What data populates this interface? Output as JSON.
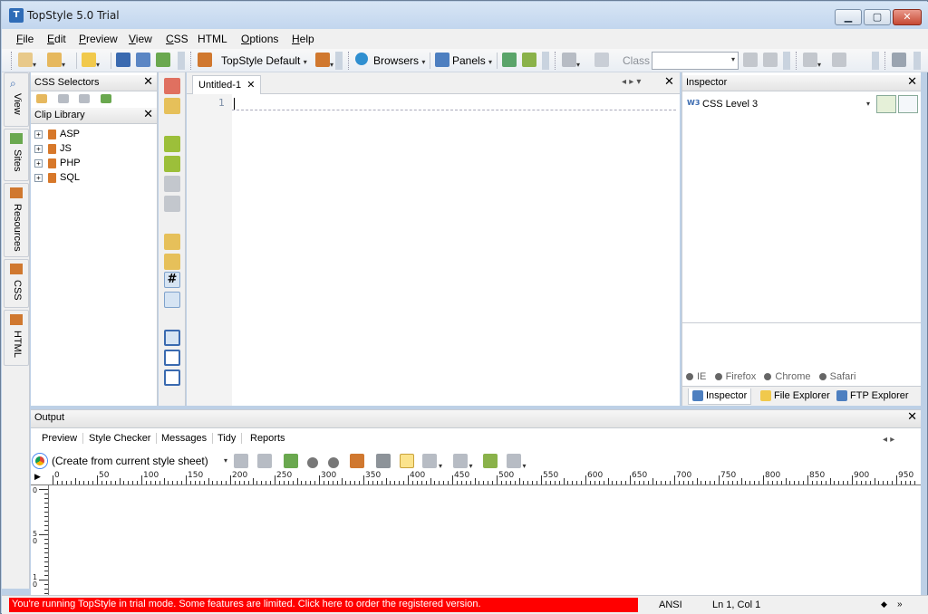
{
  "window": {
    "title": "TopStyle 5.0 Trial",
    "min": "▁",
    "max": "▢",
    "close": "✕"
  },
  "menu": [
    {
      "label": "File",
      "u": "F",
      "rest": "ile"
    },
    {
      "label": "Edit",
      "u": "E",
      "rest": "dit"
    },
    {
      "label": "Preview",
      "u": "P",
      "rest": "review"
    },
    {
      "label": "View",
      "u": "V",
      "rest": "iew"
    },
    {
      "label": "CSS",
      "u": "C",
      "rest": "SS"
    },
    {
      "label": "HTML",
      "u": "",
      "rest": "HTML"
    },
    {
      "label": "Options",
      "u": "O",
      "rest": "ptions"
    },
    {
      "label": "Help",
      "u": "H",
      "rest": "elp"
    }
  ],
  "toolbar": {
    "style_label": "TopStyle Default",
    "browsers_label": "Browsers",
    "panels_label": "Panels",
    "class_label": "Class",
    "class_value": ""
  },
  "sidetabs": [
    "View",
    "Sites",
    "Resources",
    "CSS",
    "HTML"
  ],
  "left": {
    "css_selectors": "CSS Selectors",
    "clip_library": "Clip Library",
    "items": [
      "ASP",
      "JS",
      "PHP",
      "SQL"
    ],
    "close": "✕"
  },
  "editor": {
    "tab": "Untitled-1",
    "tab_close": "✕",
    "line_no": "1",
    "nav": "◂ ▸ ▾",
    "close": "✕"
  },
  "inspector": {
    "title": "Inspector",
    "close": "✕",
    "level": "CSS Level 3",
    "w3": "W3",
    "browsers": [
      "IE",
      "Firefox",
      "Chrome",
      "Safari"
    ],
    "tabs": [
      "Inspector",
      "File Explorer",
      "FTP Explorer"
    ]
  },
  "output": {
    "title": "Output",
    "close": "✕",
    "tabs": [
      "Preview",
      "Style Checker",
      "Messages",
      "Tidy",
      "Reports"
    ],
    "source": "(Create from current style sheet)",
    "ruler": [
      "0",
      "50",
      "100",
      "150",
      "200",
      "250",
      "300",
      "350",
      "400",
      "450",
      "500",
      "550",
      "600",
      "650",
      "700",
      "750",
      "800",
      "850",
      "900",
      "950"
    ],
    "vruler": [
      "0",
      "50",
      "10"
    ],
    "nav": "◂ ▸"
  },
  "status": {
    "trial": "You're running TopStyle in trial mode. Some features are limited. Click here to order the registered version.",
    "encoding": "ANSI",
    "position": "Ln 1, Col 1"
  },
  "colors": {
    "trial_bg": "#ff0000",
    "accent": "#2f6cb7"
  }
}
